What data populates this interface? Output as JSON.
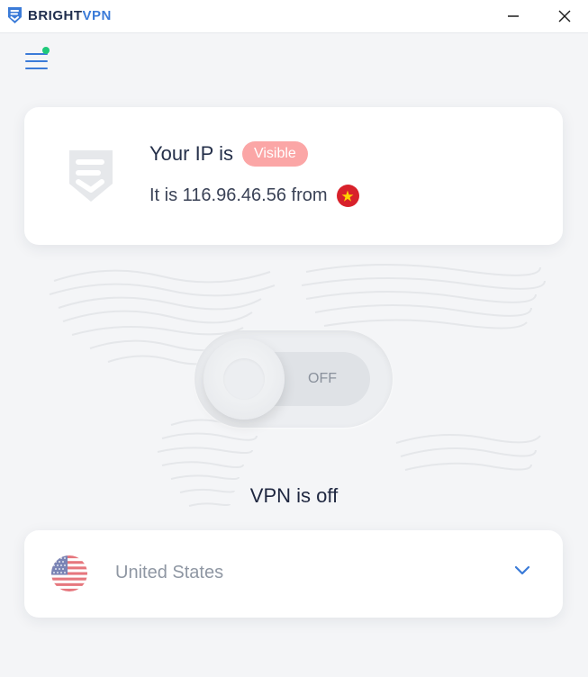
{
  "app": {
    "brand_part1": "BRIGHT",
    "brand_part2": "VPN"
  },
  "window_controls": {
    "minimize_icon": "minimize-icon",
    "close_icon": "close-icon"
  },
  "menu": {
    "icon": "hamburger-menu-icon",
    "notification_dot_color": "#1fc97a"
  },
  "ip_card": {
    "label": "Your IP is",
    "status_badge": "Visible",
    "location_prefix": "It is 116.96.46.56 from",
    "flag_icon": "vietnam-flag-icon"
  },
  "vpn_toggle": {
    "state_label": "OFF",
    "is_on": false
  },
  "status_text": "VPN is off",
  "country_selector": {
    "flag_icon": "us-flag-icon",
    "selected_country": "United States",
    "chevron_icon": "chevron-down-icon"
  },
  "colors": {
    "accent": "#3b7bd8",
    "badge_bg": "#fba6a6",
    "brand_dark": "#1f2d4d"
  }
}
